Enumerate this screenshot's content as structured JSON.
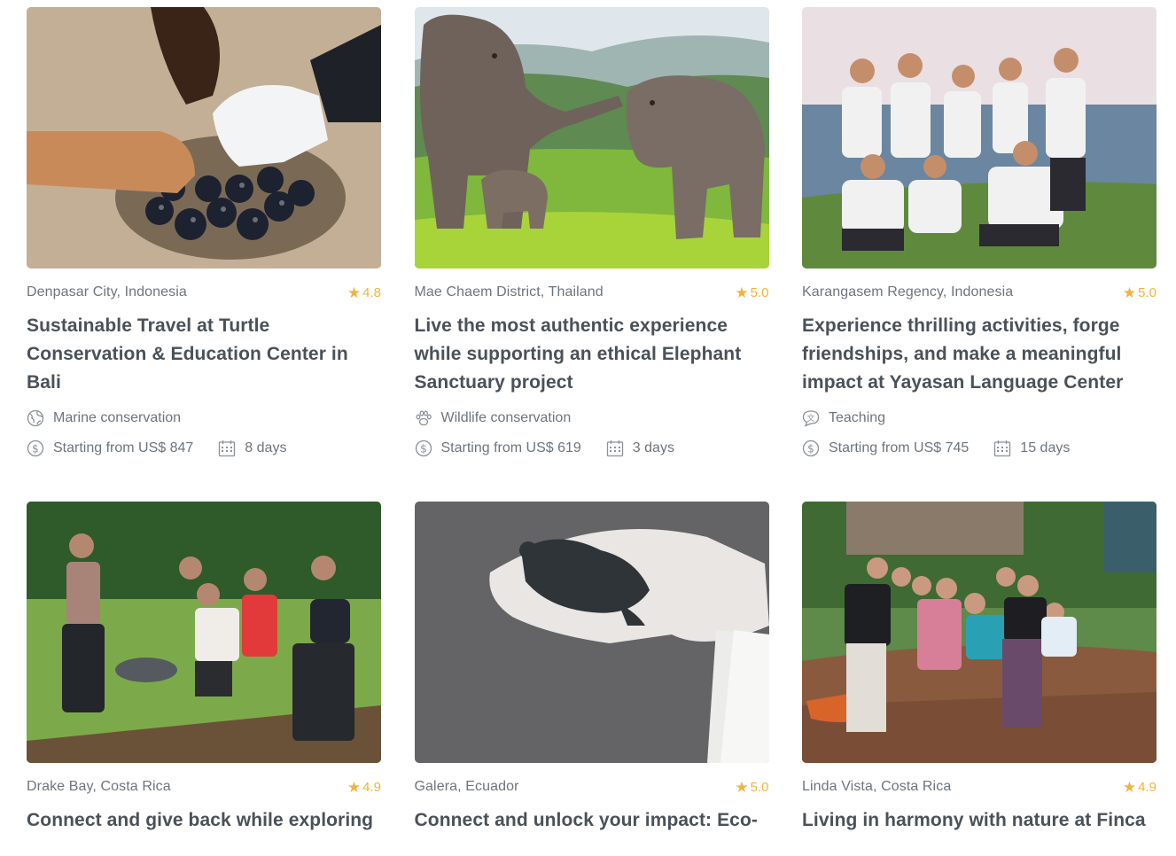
{
  "cards": [
    {
      "location": "Denpasar City, Indonesia",
      "rating": "4.8",
      "title": "Sustainable Travel at Turtle Conservation & Education Center in Bali",
      "category": "Marine conservation",
      "category_icon": "globe-icon",
      "price": "Starting from US$ 847",
      "duration": "8 days"
    },
    {
      "location": "Mae Chaem District, Thailand",
      "rating": "5.0",
      "title": "Live the most authentic experience while supporting an ethical Elephant Sanctuary project",
      "category": "Wildlife conservation",
      "category_icon": "paw-icon",
      "price": "Starting from US$ 619",
      "duration": "3 days"
    },
    {
      "location": "Karangasem Regency, Indonesia",
      "rating": "5.0",
      "title": "Experience thrilling activities, forge friendships, and make a meaningful impact at Yayasan Language Center",
      "category": "Teaching",
      "category_icon": "chat-bubble-icon",
      "price": "Starting from US$ 745",
      "duration": "15 days"
    },
    {
      "location": "Drake Bay, Costa Rica",
      "rating": "4.9",
      "title": "Connect and give back while exploring"
    },
    {
      "location": "Galera, Ecuador",
      "rating": "5.0",
      "title": "Connect and unlock your impact: Eco-"
    },
    {
      "location": "Linda Vista, Costa Rica",
      "rating": "4.9",
      "title": "Living in harmony with nature at Finca"
    }
  ],
  "colors": {
    "star": "#f0b43c",
    "text_muted": "#6d757c",
    "title": "#4a5158"
  }
}
